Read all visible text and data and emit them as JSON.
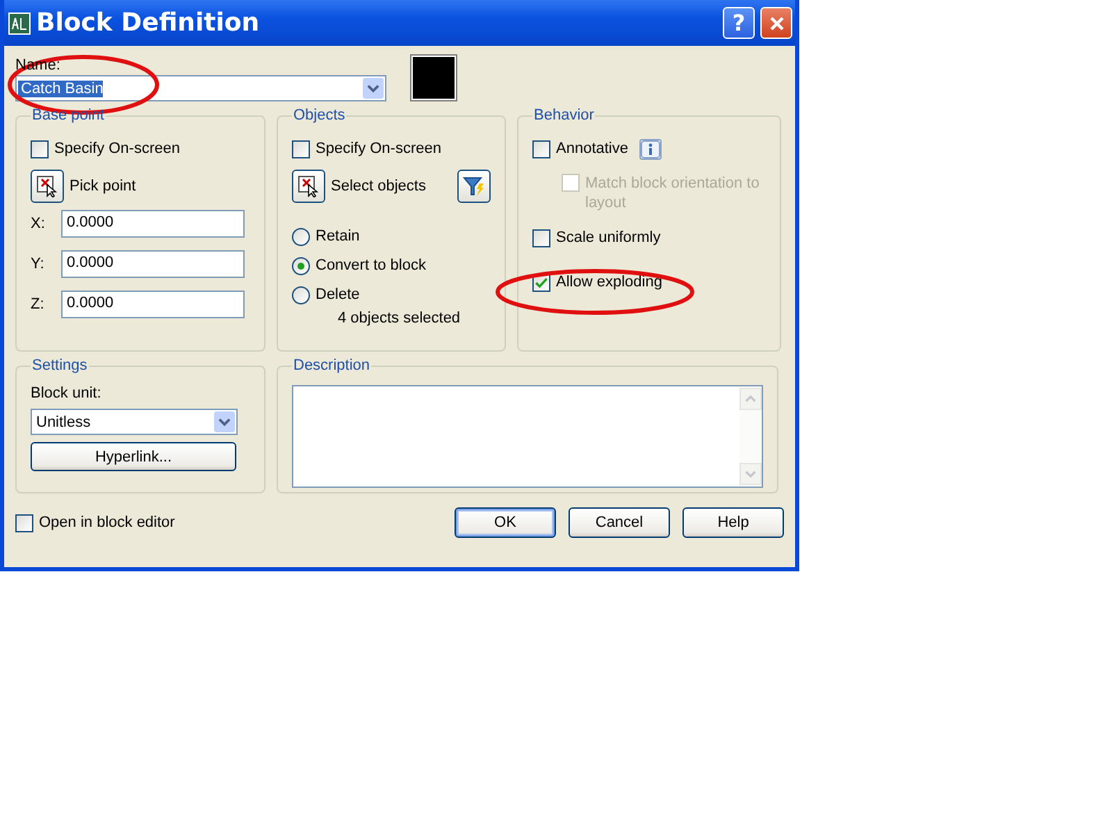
{
  "window": {
    "title": "Block Definition",
    "help_glyph": "?"
  },
  "name": {
    "label": "Name:",
    "value": "Catch Basin",
    "highlighted": true
  },
  "base_point": {
    "title": "Base point",
    "specify": {
      "label": "Specify On-screen",
      "checked": false
    },
    "pick_button": "Pick point",
    "coords": [
      {
        "label": "X:",
        "value": "0.0000"
      },
      {
        "label": "Y:",
        "value": "0.0000"
      },
      {
        "label": "Z:",
        "value": "0.0000"
      }
    ]
  },
  "objects": {
    "title": "Objects",
    "specify": {
      "label": "Specify On-screen",
      "checked": false
    },
    "select_button": "Select objects",
    "options": [
      {
        "label": "Retain",
        "selected": false
      },
      {
        "label": "Convert to block",
        "selected": true
      },
      {
        "label": "Delete",
        "selected": false
      }
    ],
    "status": "4 objects selected"
  },
  "behavior": {
    "title": "Behavior",
    "options": [
      {
        "label": "Annotative",
        "checked": false,
        "disabled": false,
        "info": true,
        "children": [
          {
            "label": "Match block orientation to layout",
            "checked": false,
            "disabled": true
          }
        ]
      },
      {
        "label": "Scale uniformly",
        "checked": false,
        "disabled": false
      },
      {
        "label": "Allow exploding",
        "checked": true,
        "disabled": false
      }
    ]
  },
  "settings": {
    "title": "Settings",
    "unit_label": "Block unit:",
    "unit": "Unitless",
    "hyperlink_button": "Hyperlink..."
  },
  "description": {
    "title": "Description"
  },
  "open_in_editor": {
    "label": "Open in block editor",
    "checked": false
  },
  "buttons": [
    {
      "label": "OK",
      "default": true
    },
    {
      "label": "Cancel",
      "default": false
    },
    {
      "label": "Help",
      "default": false
    }
  ]
}
